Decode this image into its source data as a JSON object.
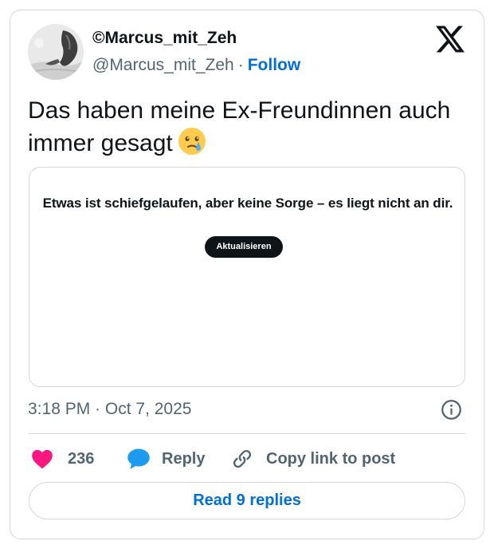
{
  "author": {
    "display_name": "©Marcus_mit_Zeh",
    "handle": "@Marcus_mit_Zeh",
    "separator": "·",
    "follow_label": "Follow"
  },
  "tweet": {
    "text_line1": "Das haben meine Ex-Freundinnen auch",
    "text_line2": "immer gesagt",
    "emoji": "face-holding-back-tears"
  },
  "embed": {
    "error_message": "Etwas ist schiefgelaufen, aber keine Sorge – es liegt nicht an dir.",
    "refresh_label": "Aktualisieren"
  },
  "meta": {
    "timestamp": "3:18 PM · Oct 7, 2025"
  },
  "actions": {
    "like_count": "236",
    "reply_label": "Reply",
    "copy_link_label": "Copy link to post"
  },
  "footer": {
    "read_replies_label": "Read 9 replies"
  },
  "colors": {
    "accent": "#006fd6",
    "like": "#f91880",
    "reply_icon": "#1d9bf0",
    "muted": "#536471",
    "border": "#cfd9de",
    "text": "#0f1419"
  },
  "icons": {
    "brand": "x-logo-icon",
    "info": "info-icon",
    "like": "heart-icon",
    "reply": "speech-bubble-icon",
    "copy": "link-icon"
  }
}
